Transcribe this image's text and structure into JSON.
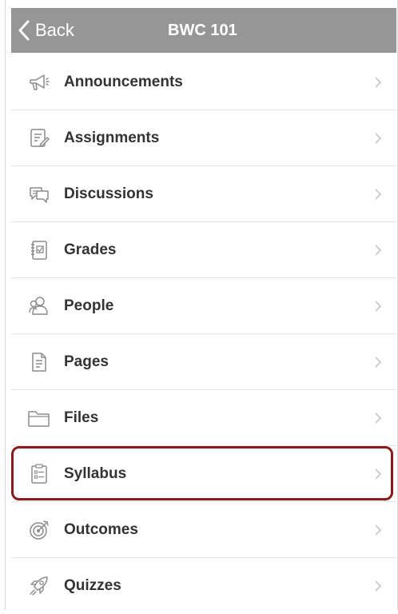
{
  "header": {
    "back_label": "Back",
    "title": "BWC 101"
  },
  "menu": {
    "items": [
      {
        "label": "Announcements",
        "icon": "megaphone-icon"
      },
      {
        "label": "Assignments",
        "icon": "assignment-icon"
      },
      {
        "label": "Discussions",
        "icon": "discussion-icon"
      },
      {
        "label": "Grades",
        "icon": "gradebook-icon"
      },
      {
        "label": "People",
        "icon": "people-icon"
      },
      {
        "label": "Pages",
        "icon": "page-icon"
      },
      {
        "label": "Files",
        "icon": "folder-icon"
      },
      {
        "label": "Syllabus",
        "icon": "syllabus-icon",
        "highlighted": true
      },
      {
        "label": "Outcomes",
        "icon": "outcomes-icon"
      },
      {
        "label": "Quizzes",
        "icon": "quiz-rocket-icon"
      }
    ]
  },
  "colors": {
    "navbar": "#969696",
    "highlight_border": "#8b1a1a",
    "label_text": "#333333",
    "icon_stroke": "#8c8c8c"
  }
}
